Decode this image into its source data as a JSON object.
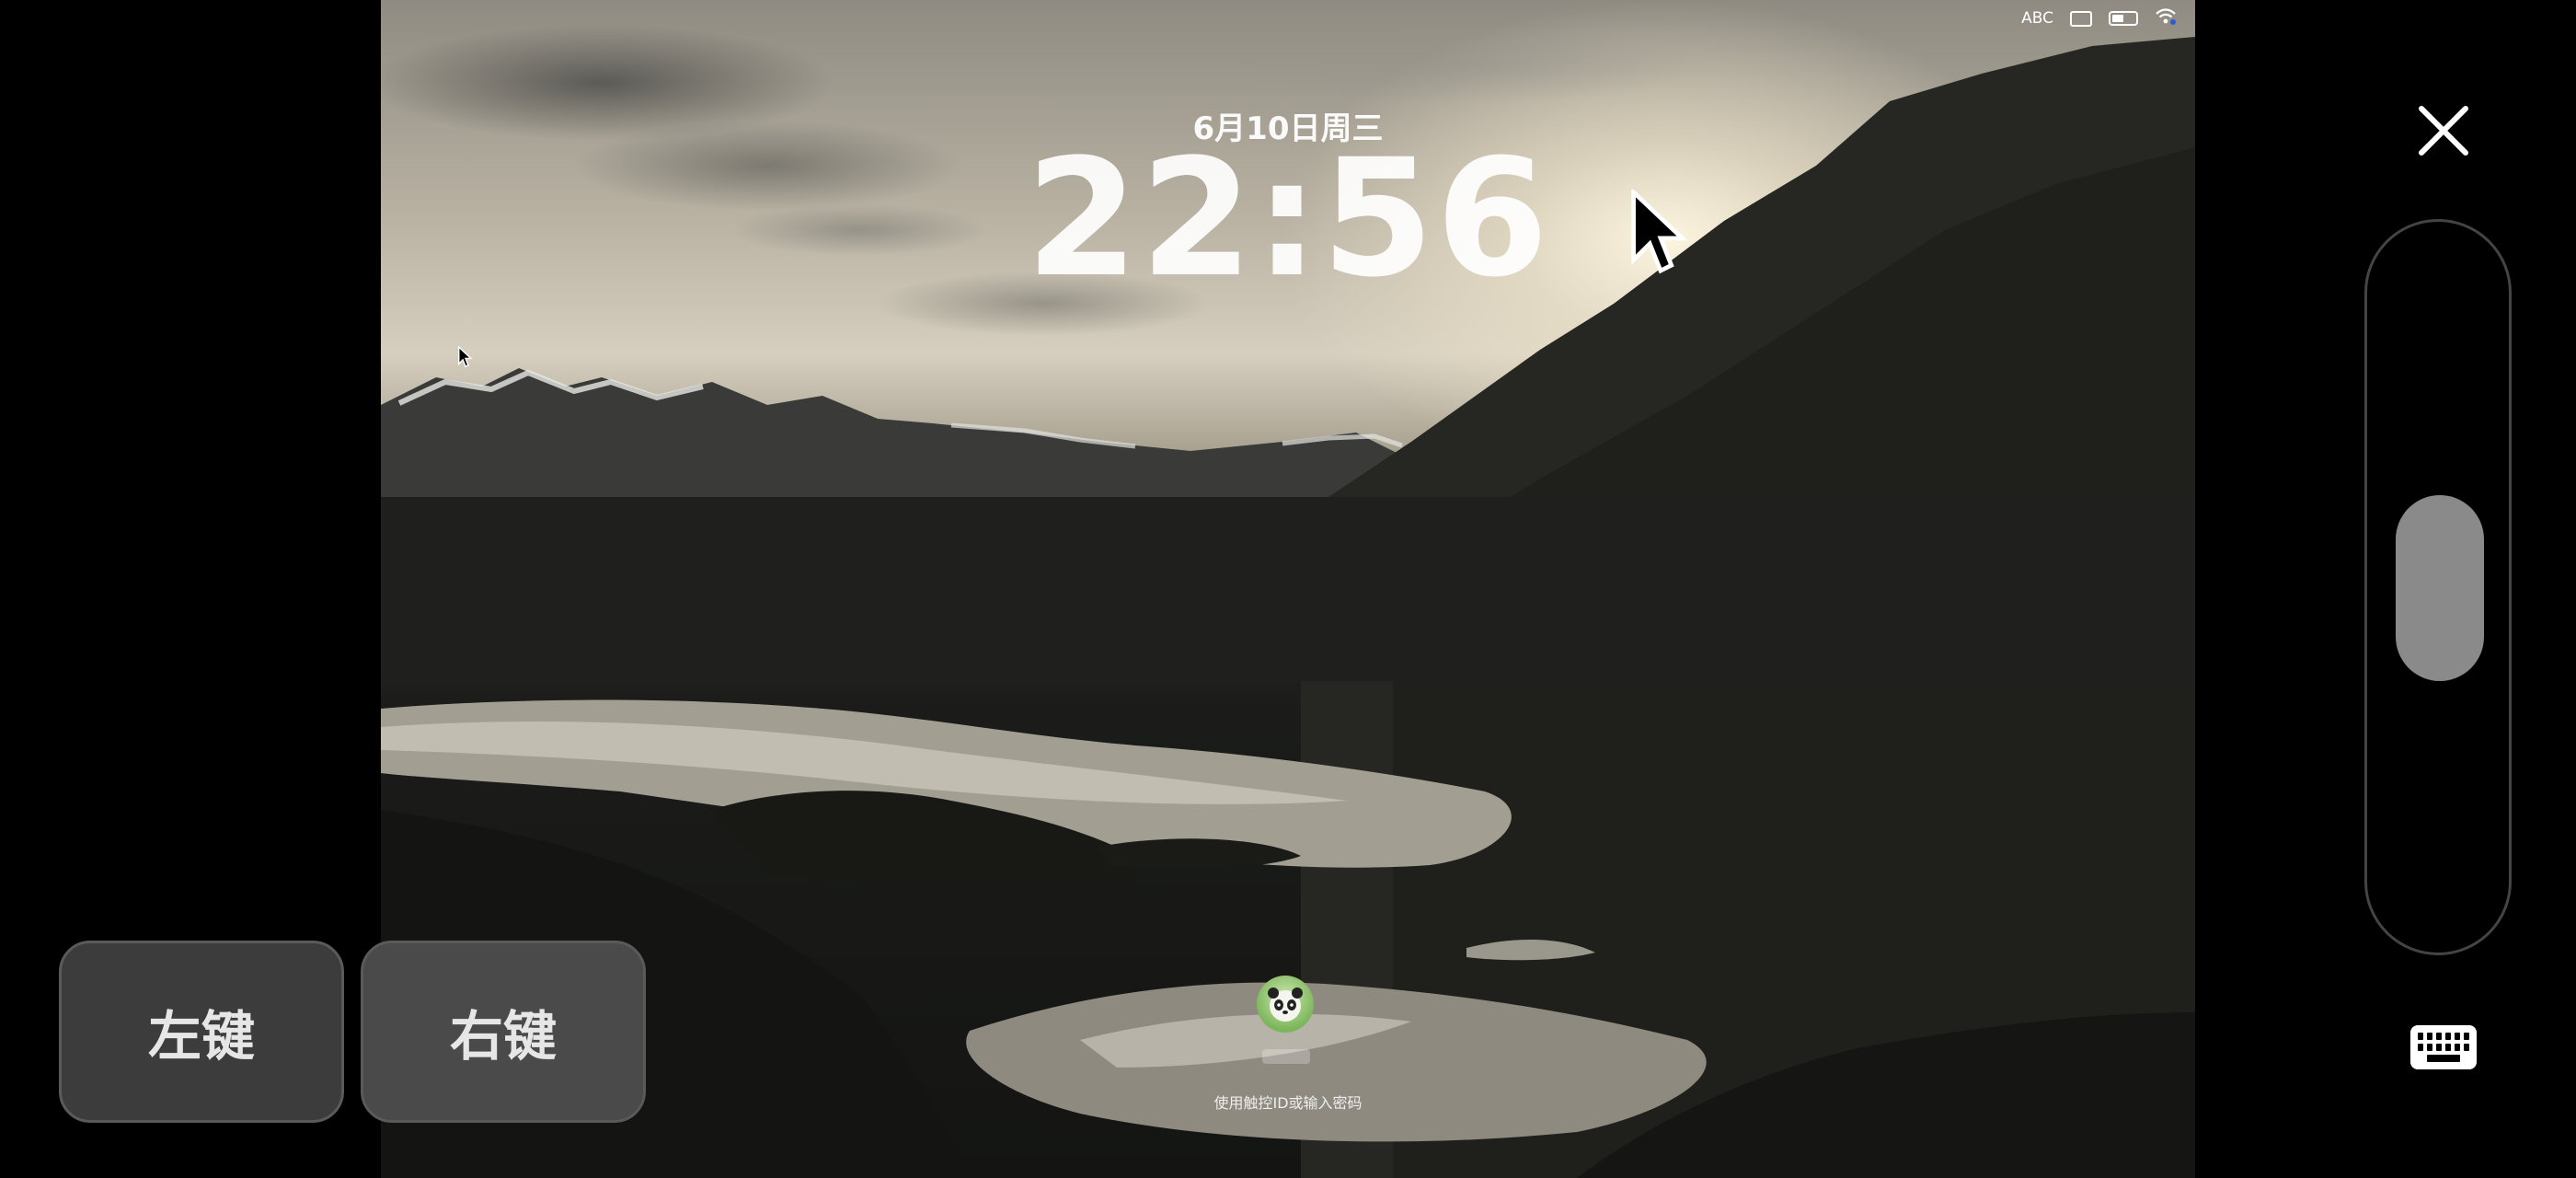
{
  "remote": {
    "status_bar": {
      "input_source": "ABC",
      "icons": [
        "keyboard-icon",
        "battery-icon",
        "wifi-icon"
      ]
    },
    "lock_screen": {
      "date": "6月10日周三",
      "time": "22:56",
      "login_hint": "使用触控ID或输入密码",
      "avatar_icon": "panda-avatar-icon"
    }
  },
  "controls": {
    "left_click_label": "左键",
    "right_click_label": "右键",
    "close_icon": "close-icon",
    "keyboard_icon": "keyboard-icon"
  }
}
